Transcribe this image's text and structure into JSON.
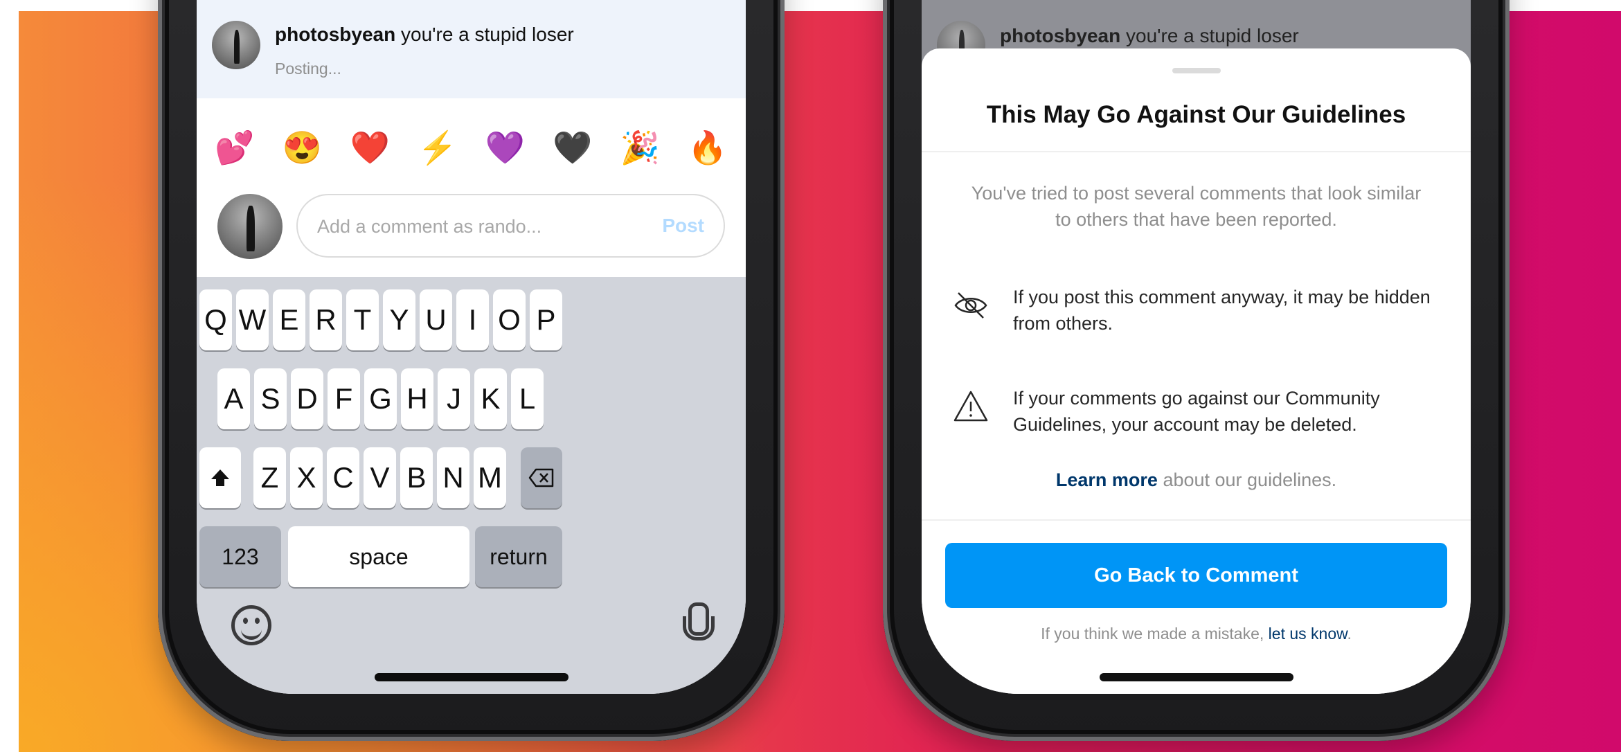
{
  "colors": {
    "accent_blue": "#0095f6",
    "link_blue": "#00376b",
    "post_disabled": "#b3dbff",
    "bg_orange": "#f58a3a",
    "bg_magenta": "#d10a6b"
  },
  "left_phone": {
    "comment": {
      "username": "photosbyean",
      "text": " you're a stupid loser",
      "status": "Posting..."
    },
    "emojis": [
      "💕",
      "😍",
      "❤️",
      "⚡",
      "💜",
      "🖤",
      "🎉",
      "🔥"
    ],
    "input": {
      "placeholder": "Add a comment as rando...",
      "post_label": "Post"
    },
    "keyboard": {
      "row1": [
        "Q",
        "W",
        "E",
        "R",
        "T",
        "Y",
        "U",
        "I",
        "O",
        "P"
      ],
      "row2": [
        "A",
        "S",
        "D",
        "F",
        "G",
        "H",
        "J",
        "K",
        "L"
      ],
      "row3": [
        "Z",
        "X",
        "C",
        "V",
        "B",
        "N",
        "M"
      ],
      "shift_icon": "shift-icon",
      "backspace_icon": "backspace-icon",
      "numbers_label": "123",
      "space_label": "space",
      "return_label": "return",
      "emoji_icon": "emoji-keyboard-icon",
      "mic_icon": "microphone-icon"
    }
  },
  "right_phone": {
    "comment": {
      "username": "photosbyean",
      "text": " you're a stupid loser"
    },
    "sheet": {
      "title": "This May Go Against Our Guidelines",
      "description": "You've tried to post several comments that look similar to others that have been reported.",
      "bullets": [
        {
          "icon": "eye-slash-icon",
          "text": "If you post this comment anyway, it may be hidden from others."
        },
        {
          "icon": "warning-triangle-icon",
          "text": "If your comments go against our Community Guidelines, your account may be deleted."
        }
      ],
      "learn_link": "Learn more",
      "learn_rest": " about our guidelines.",
      "button_label": "Go Back to Comment",
      "mistake_prefix": "If you think we made a mistake, ",
      "mistake_link": "let us know",
      "mistake_suffix": "."
    }
  }
}
